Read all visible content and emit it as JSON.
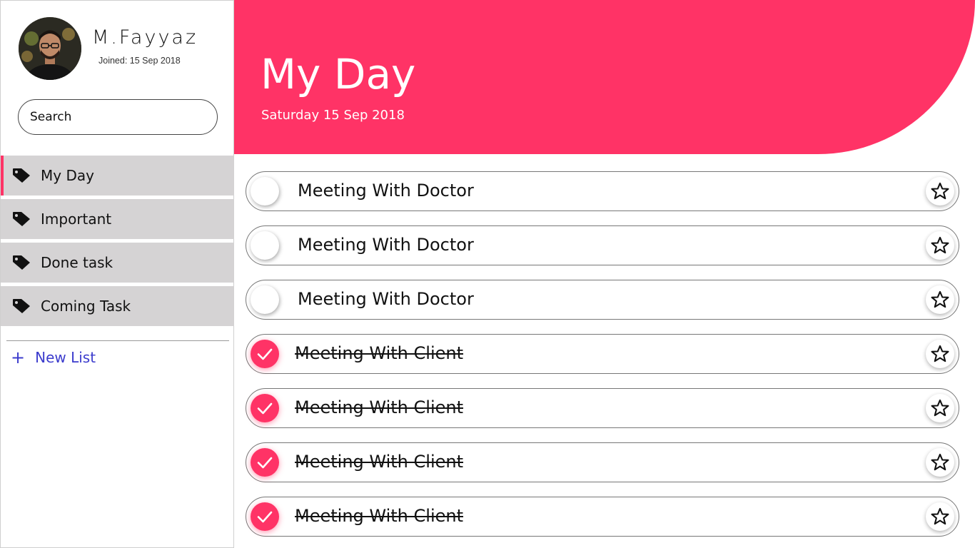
{
  "user": {
    "name": "M.Fayyaz",
    "joined": "Joined: 15 Sep 2018"
  },
  "search": {
    "placeholder": "Search"
  },
  "sidebar": {
    "items": [
      {
        "label": "My Day",
        "icon": "tag-icon",
        "active": true
      },
      {
        "label": "Important",
        "icon": "tag-icon",
        "active": false
      },
      {
        "label": "Done task",
        "icon": "tag-icon",
        "active": false
      },
      {
        "label": "Coming Task",
        "icon": "tag-icon",
        "active": false
      }
    ],
    "new_list_label": "New List",
    "new_list_icon": "plus-icon"
  },
  "header": {
    "title": "My Day",
    "date": "Saturday 15 Sep 2018"
  },
  "tasks": [
    {
      "text": "Meeting With Doctor",
      "done": false
    },
    {
      "text": "Meeting With Doctor",
      "done": false
    },
    {
      "text": "Meeting With Doctor",
      "done": false
    },
    {
      "text": "Meeting With Client",
      "done": true
    },
    {
      "text": "Meeting With Client",
      "done": true
    },
    {
      "text": "Meeting With Client",
      "done": true
    },
    {
      "text": "Meeting With Client",
      "done": true
    }
  ],
  "colors": {
    "accent": "#ff3366",
    "nav_bg": "#d5d3d4",
    "link": "#3c3ccd"
  }
}
